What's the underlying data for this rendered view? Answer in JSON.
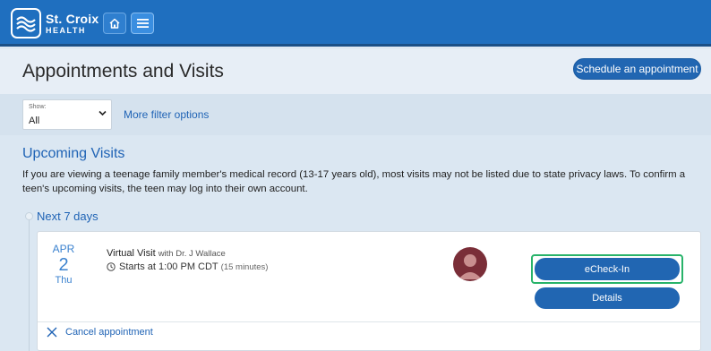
{
  "brand": {
    "name_line1": "St. Croix",
    "name_line2": "HEALTH",
    "color": "#1f6fbf"
  },
  "topbar": {
    "home_icon": "home-icon",
    "menu_icon": "menu-icon"
  },
  "header": {
    "title": "Appointments and Visits",
    "schedule_label": "Schedule an appointment"
  },
  "filters": {
    "show_label": "Show:",
    "show_value": "All",
    "more_label": "More filter options"
  },
  "upcoming": {
    "title": "Upcoming Visits",
    "note": "If you are viewing a teenage family member's medical record (13-17 years old), most visits may not be listed due to state privacy laws. To confirm a teen's upcoming visits, the teen may log into their own account.",
    "group_title": "Next 7 days",
    "visits": [
      {
        "month": "APR",
        "day": "2",
        "weekday": "Thu",
        "type": "Virtual Visit",
        "provider": "with Dr. J Wallace",
        "time": "Starts at 1:00 PM CDT",
        "duration": "(15 minutes)",
        "echeck_label": "eCheck-In",
        "details_label": "Details",
        "cancel_label": "Cancel appointment"
      }
    ]
  },
  "colors": {
    "accent": "#2166b2",
    "link": "#1f63b5",
    "highlight_outline": "#28b36a",
    "avatar": "#7a2e38"
  }
}
